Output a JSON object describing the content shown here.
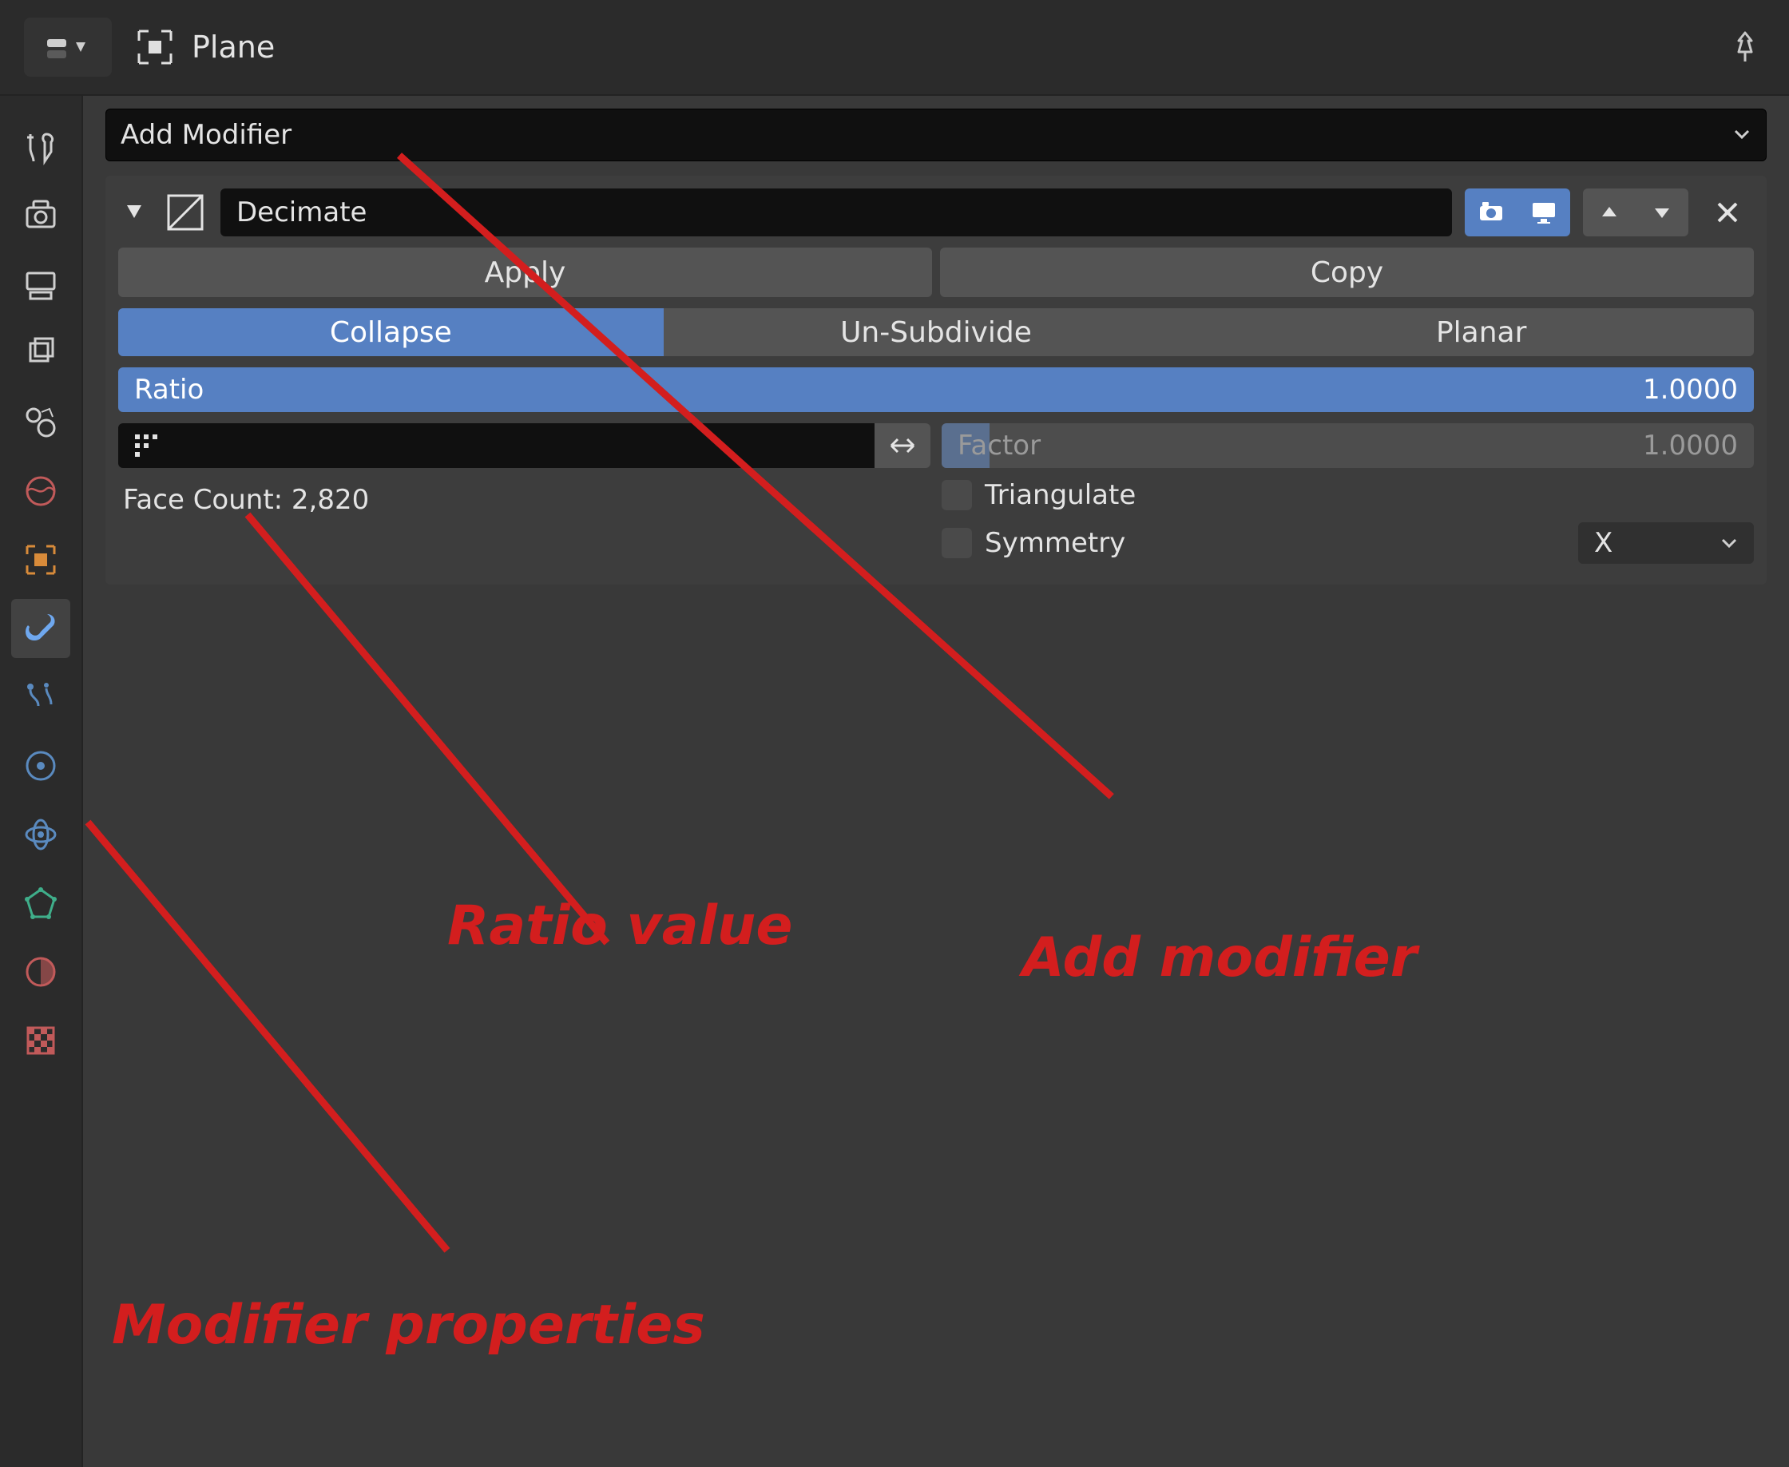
{
  "header": {
    "object_name": "Plane"
  },
  "add_modifier_label": "Add Modifier",
  "modifier": {
    "name": "Decimate",
    "apply_label": "Apply",
    "copy_label": "Copy",
    "mode_tabs": {
      "collapse": "Collapse",
      "unsubdivide": "Un-Subdivide",
      "planar": "Planar"
    },
    "ratio_label": "Ratio",
    "ratio_value": "1.0000",
    "factor_label": "Factor",
    "factor_value": "1.0000",
    "face_count": "Face Count: 2,820",
    "triangulate_label": "Triangulate",
    "symmetry_label": "Symmetry",
    "symmetry_axis": "X"
  },
  "annotations": {
    "ratio_value": "Ratio value",
    "add_modifier": "Add modifier",
    "modifier_properties": "Modifier properties"
  }
}
